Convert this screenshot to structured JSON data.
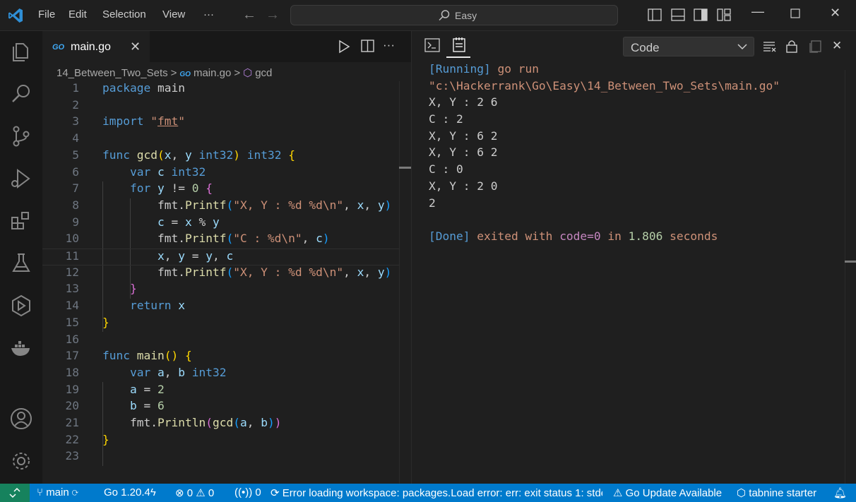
{
  "titlebar": {
    "menu": [
      "File",
      "Edit",
      "Selection",
      "View",
      "···"
    ],
    "search_text": "Easy"
  },
  "editor": {
    "tab_icon": "GO",
    "tab_name": "main.go",
    "breadcrumb": [
      "14_Between_Two_Sets",
      ">",
      "main.go",
      ">",
      "gcd"
    ],
    "line_numbers": [
      "1",
      "2",
      "3",
      "4",
      "5",
      "6",
      "7",
      "8",
      "9",
      "10",
      "11",
      "12",
      "13",
      "14",
      "15",
      "16",
      "17",
      "18",
      "19",
      "20",
      "21",
      "22",
      "23"
    ]
  },
  "panel": {
    "select_value": "Code",
    "output": [
      {
        "type": "running",
        "parts": [
          "[Running]",
          " go run"
        ]
      },
      {
        "type": "path",
        "parts": [
          "\"c:\\Hackerrank\\Go\\Easy\\14_Between_Two_Sets\\main.go\""
        ]
      },
      {
        "type": "plain",
        "parts": [
          "X, Y : 2 6"
        ]
      },
      {
        "type": "plain",
        "parts": [
          "C : 2"
        ]
      },
      {
        "type": "plain",
        "parts": [
          "X, Y : 6 2"
        ]
      },
      {
        "type": "plain",
        "parts": [
          "X, Y : 6 2"
        ]
      },
      {
        "type": "plain",
        "parts": [
          "C : 0"
        ]
      },
      {
        "type": "plain",
        "parts": [
          "X, Y : 2 0"
        ]
      },
      {
        "type": "plain",
        "parts": [
          "2"
        ]
      },
      {
        "type": "plain",
        "parts": [
          ""
        ]
      },
      {
        "type": "done",
        "parts": [
          "[Done]",
          " exited with ",
          "code=0",
          " in ",
          "1.806",
          " seconds"
        ]
      }
    ]
  },
  "statusbar": {
    "branch": "main",
    "go_version": "Go 1.20.4",
    "errors": "0",
    "warnings": "0",
    "ports": "0",
    "workspace_error": "Error loading workspace: packages.Load error: err: exit status 1: stde",
    "go_update": "Go Update Available",
    "tabnine": "tabnine starter"
  },
  "colors": {
    "accent": "#007acc",
    "remote": "#16825d",
    "background": "#1f1f1f"
  }
}
